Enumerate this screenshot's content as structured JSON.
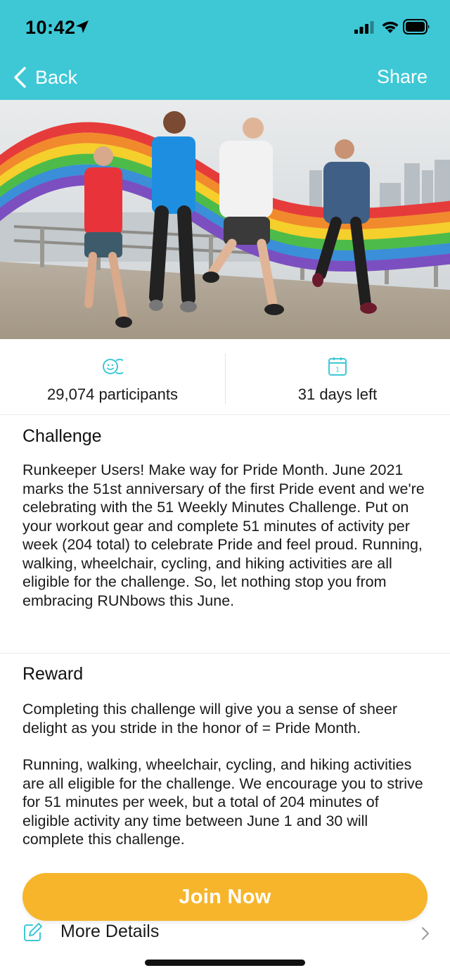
{
  "status_bar": {
    "time": "10:42"
  },
  "nav": {
    "back_label": "Back",
    "share_label": "Share"
  },
  "colors": {
    "header_bg": "#3ec8d6",
    "accent": "#3ec8d6",
    "join_button": "#f6b52b"
  },
  "hero": {
    "image_desc": "runners-with-rainbow"
  },
  "stats": {
    "participants": "29,074 participants",
    "days_left": "31 days left",
    "calendar_day": "1"
  },
  "challenge": {
    "title": "Challenge",
    "body": "Runkeeper Users! Make way for Pride Month. June 2021 marks the 51st anniversary of the first Pride event and we're celebrating with the 51 Weekly Minutes Challenge. Put on your workout gear and complete 51 minutes of activity per week (204 total) to celebrate Pride and feel proud. Running, walking, wheelchair, cycling, and hiking activities are all eligible for the challenge. So, let nothing stop you from embracing RUNbows this June."
  },
  "reward": {
    "title": "Reward",
    "para1": "Completing this challenge will give you a sense of sheer delight as you stride in the honor of = Pride Month.",
    "para2": "Running, walking, wheelchair, cycling, and hiking activities are all eligible for the challenge. We encourage you to strive for 51 minutes per week, but a total of 204 minutes of eligible activity any time between June 1 and 30 will complete this challenge."
  },
  "more_details": {
    "label": "More Details"
  },
  "join": {
    "label": "Join Now"
  }
}
